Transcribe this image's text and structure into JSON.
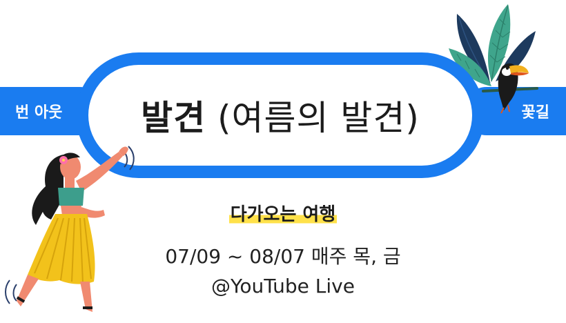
{
  "title": {
    "bold": "발견",
    "rest": "(여름의 발견)"
  },
  "stations": {
    "left": "번 아웃",
    "right": "꽃길"
  },
  "tagline": "다가오는 여행",
  "schedule": "07/09 ~ 08/07 매주 목, 금",
  "venue": "@YouTube Live",
  "colors": {
    "track": "#1a7cf0",
    "highlight": "#ffe14a",
    "text": "#1c1c1c"
  },
  "icons": [
    "palm-leaves-icon",
    "toucan-icon",
    "hula-dancer-icon",
    "hibiscus-icon"
  ]
}
